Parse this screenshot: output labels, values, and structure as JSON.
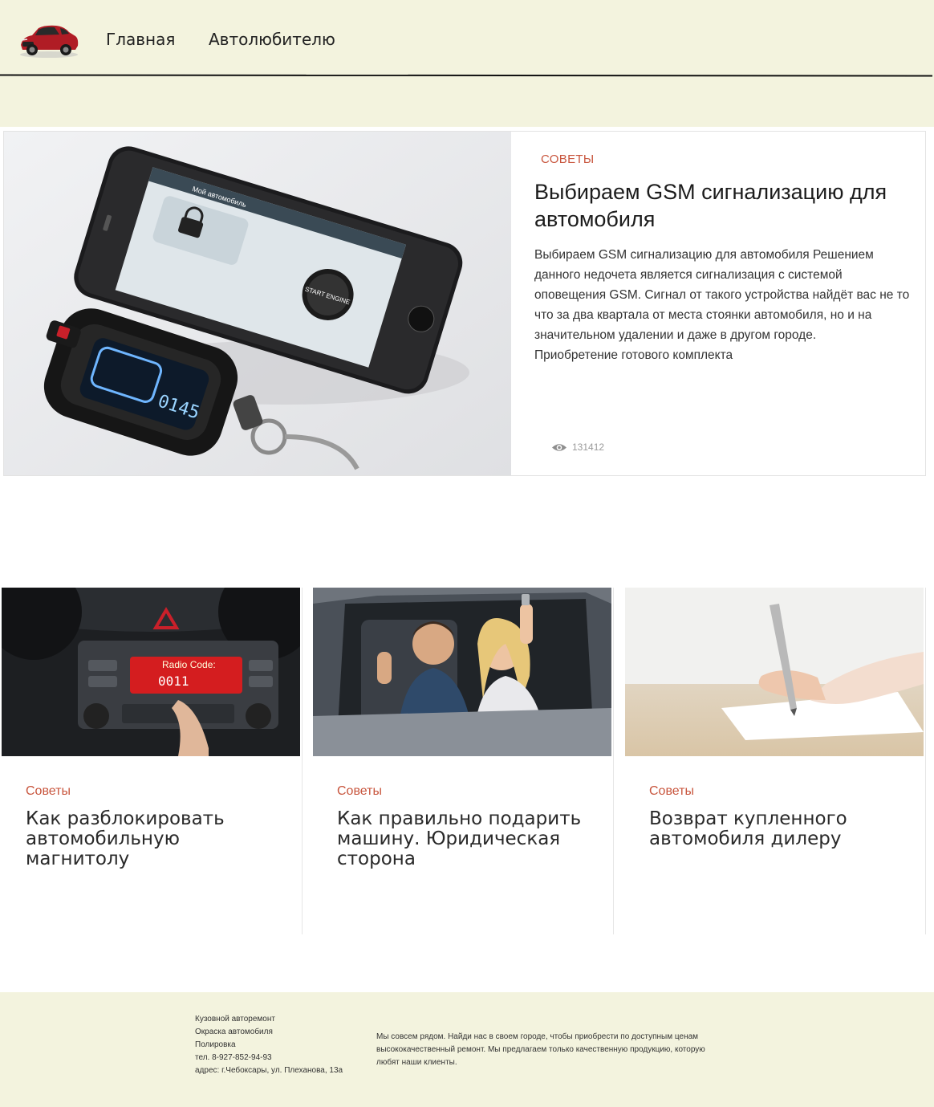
{
  "nav": {
    "items": [
      "Главная",
      "Автолюбителю"
    ]
  },
  "featured": {
    "category": "СОВЕТЫ",
    "title": "Выбираем GSM сигнализацию для автомобиля",
    "text": "Выбираем GSM сигнализацию для автомобиля Решением данного недочета является сигнализация с системой оповещения GSM. Сигнал от такого устройства найдёт вас не то что за два квартала от места стоянки автомобиля, но и на значительном удалении и даже в другом городе.",
    "text_extra": "Приобретение готового комплекта",
    "views": "131412",
    "image": {
      "remote_screen_text": "0145",
      "phone_button_text": "START ENGINE",
      "phone_header": "Мой автомобиль"
    }
  },
  "cards": [
    {
      "category": "Советы",
      "title": "Как разблокировать автомобильную магнитолу",
      "image": {
        "screen_label": "Radio Code:",
        "screen_code": "0011"
      }
    },
    {
      "category": "Советы",
      "title": "Как правильно подарить машину. Юридическая сторона"
    },
    {
      "category": "Советы",
      "title": "Возврат купленного автомобиля дилеру"
    }
  ],
  "footer": {
    "services": [
      "Кузовной авторемонт",
      "Окраска автомобиля",
      "Полировка"
    ],
    "phone": "тел. 8-927-852-94-93",
    "address": "адрес: г.Чебоксары, ул. Плеханова, 13а",
    "about": "Мы совсем рядом. Найди нас в своем городе, чтобы приобрести по доступным ценам высококачественный ремонт. Мы предлагаем только качественную продукцию, которую любят наши клиенты."
  },
  "colors": {
    "accent": "#c8553d",
    "header_bg": "#f3f3de"
  }
}
